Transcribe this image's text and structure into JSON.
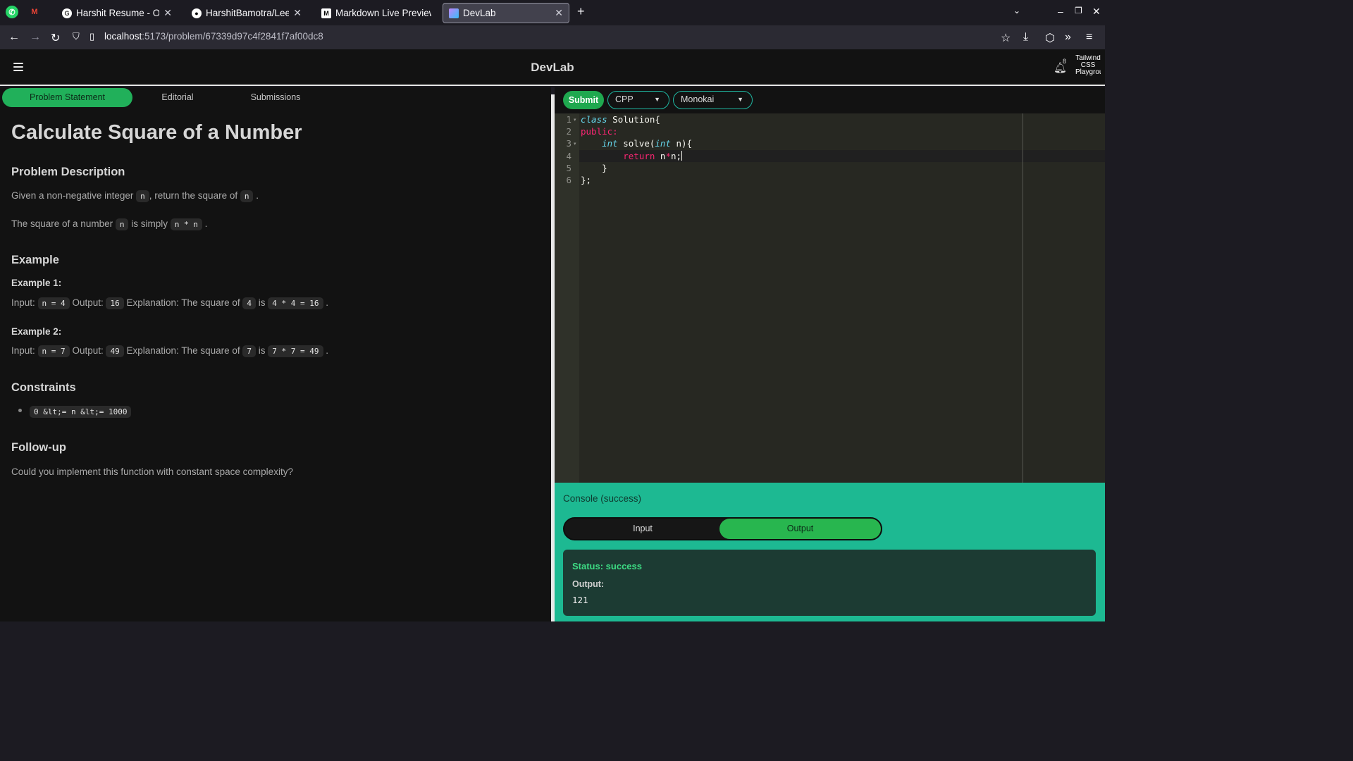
{
  "browser": {
    "tabs": [
      {
        "title": "Harshit Resume - Online",
        "favicon": "G"
      },
      {
        "title": "HarshitBamotra/Leetcod",
        "favicon": "github"
      },
      {
        "title": "Markdown Live Preview",
        "favicon": "M"
      },
      {
        "title": "DevLab",
        "favicon": "devlab"
      }
    ],
    "url_host": "localhost",
    "url_path": ":5173/problem/67339d97c4f2841f7af00dc8"
  },
  "app": {
    "brand": "DevLab",
    "notification_count": "8",
    "avatar_text": "Tailwind CSS Playground"
  },
  "problem": {
    "tabs": [
      "Problem Statement",
      "Editorial",
      "Submissions"
    ],
    "active_tab": "Problem Statement",
    "title": "Calculate Square of a Number",
    "description_heading": "Problem Description",
    "desc1_pre": "Given a non-negative integer",
    "desc1_code": "n",
    "desc1_mid": ", return the square of",
    "desc1_code2": "n",
    "desc1_end": ".",
    "desc2_pre": "The square of a number",
    "desc2_code": "n",
    "desc2_mid": "is simply",
    "desc2_code2": "n * n",
    "desc2_end": ".",
    "example_heading": "Example",
    "examples": [
      {
        "label": "Example 1:",
        "input_label": "Input:",
        "input": "n = 4",
        "output_label": "Output:",
        "output": "16",
        "expl_label": "Explanation: The square of",
        "expl_n": "4",
        "is": "is",
        "expl_calc": "4 * 4 = 16",
        "end": "."
      },
      {
        "label": "Example 2:",
        "input_label": "Input:",
        "input": "n = 7",
        "output_label": "Output:",
        "output": "49",
        "expl_label": "Explanation: The square of",
        "expl_n": "7",
        "is": "is",
        "expl_calc": "7 * 7 = 49",
        "end": "."
      }
    ],
    "constraints_heading": "Constraints",
    "constraints": [
      "0 &lt;= n &lt;= 1000"
    ],
    "followup_heading": "Follow-up",
    "followup_text": "Could you implement this function with constant space complexity?"
  },
  "editor": {
    "submit_label": "Submit",
    "language": "CPP",
    "theme": "Monokai",
    "line_numbers": [
      "1",
      "2",
      "3",
      "4",
      "5",
      "6"
    ],
    "code": {
      "l1_kw": "class",
      "l1_rest": " Solution{",
      "l2": "public:",
      "l3_kw": "int",
      "l3_mid": " solve(",
      "l3_kw2": "int",
      "l3_end": " n){",
      "l4_kw": "return",
      "l4_a": " n",
      "l4_op": "*",
      "l4_b": "n;",
      "l5": "}",
      "l6": "};"
    }
  },
  "console": {
    "title": "Console (success)",
    "tabs": [
      "Input",
      "Output"
    ],
    "active_tab": "Output",
    "status": "Status: success",
    "output_label": "Output:",
    "output_value": "121"
  },
  "colors": {
    "accent_green": "#28b64f",
    "console_bg": "#1db992",
    "editor_bg": "#272822"
  }
}
